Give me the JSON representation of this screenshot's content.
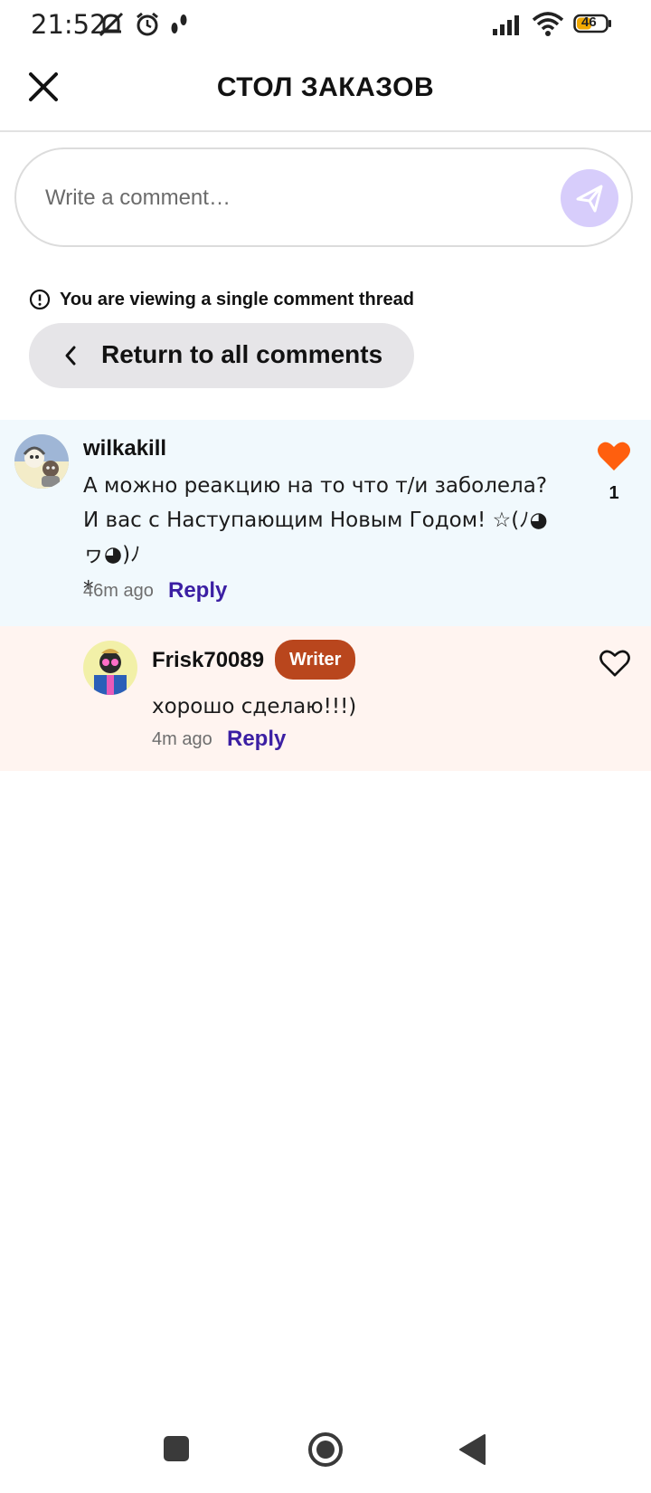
{
  "status_bar": {
    "time": "21:52",
    "battery": "46",
    "icons": [
      "muted-notifications-icon",
      "alarm-icon",
      "footsteps-icon",
      "signal-icon",
      "wifi-icon",
      "battery-icon"
    ]
  },
  "header": {
    "title": "СТОЛ ЗАКАЗОВ",
    "close_icon": "close-icon"
  },
  "comment_input": {
    "placeholder": "Write a comment…",
    "send_icon": "send-icon"
  },
  "thread_notice": {
    "text": "You are viewing a single comment thread",
    "icon": "info-icon"
  },
  "return_button": {
    "label": "Return to all comments",
    "icon": "chevron-left-icon"
  },
  "comments": [
    {
      "username": "wilkakill",
      "text": "А можно реакцию на то что т/и заболела?\nИ вас с Наступающим Новым Годом! ☆(ﾉ◕ヮ◕)ﾉ\n*",
      "time": "46m ago",
      "reply_label": "Reply",
      "likes": "1",
      "liked": true,
      "like_color": "#ff5f0e"
    },
    {
      "username": "Frisk70089",
      "badge": "Writer",
      "text": "хорошо сделаю!!!)",
      "time": "4m ago",
      "reply_label": "Reply",
      "liked": false
    }
  ],
  "colors": {
    "accent": "#3b1fa3",
    "badge": "#b9461d",
    "main_comment_bg": "#f1f9fd",
    "reply_bg": "#fff4f0",
    "send_button": "#d7cdfb"
  },
  "nav_bar": {
    "buttons": [
      "recents-square-icon",
      "home-circle-icon",
      "back-triangle-icon"
    ]
  }
}
